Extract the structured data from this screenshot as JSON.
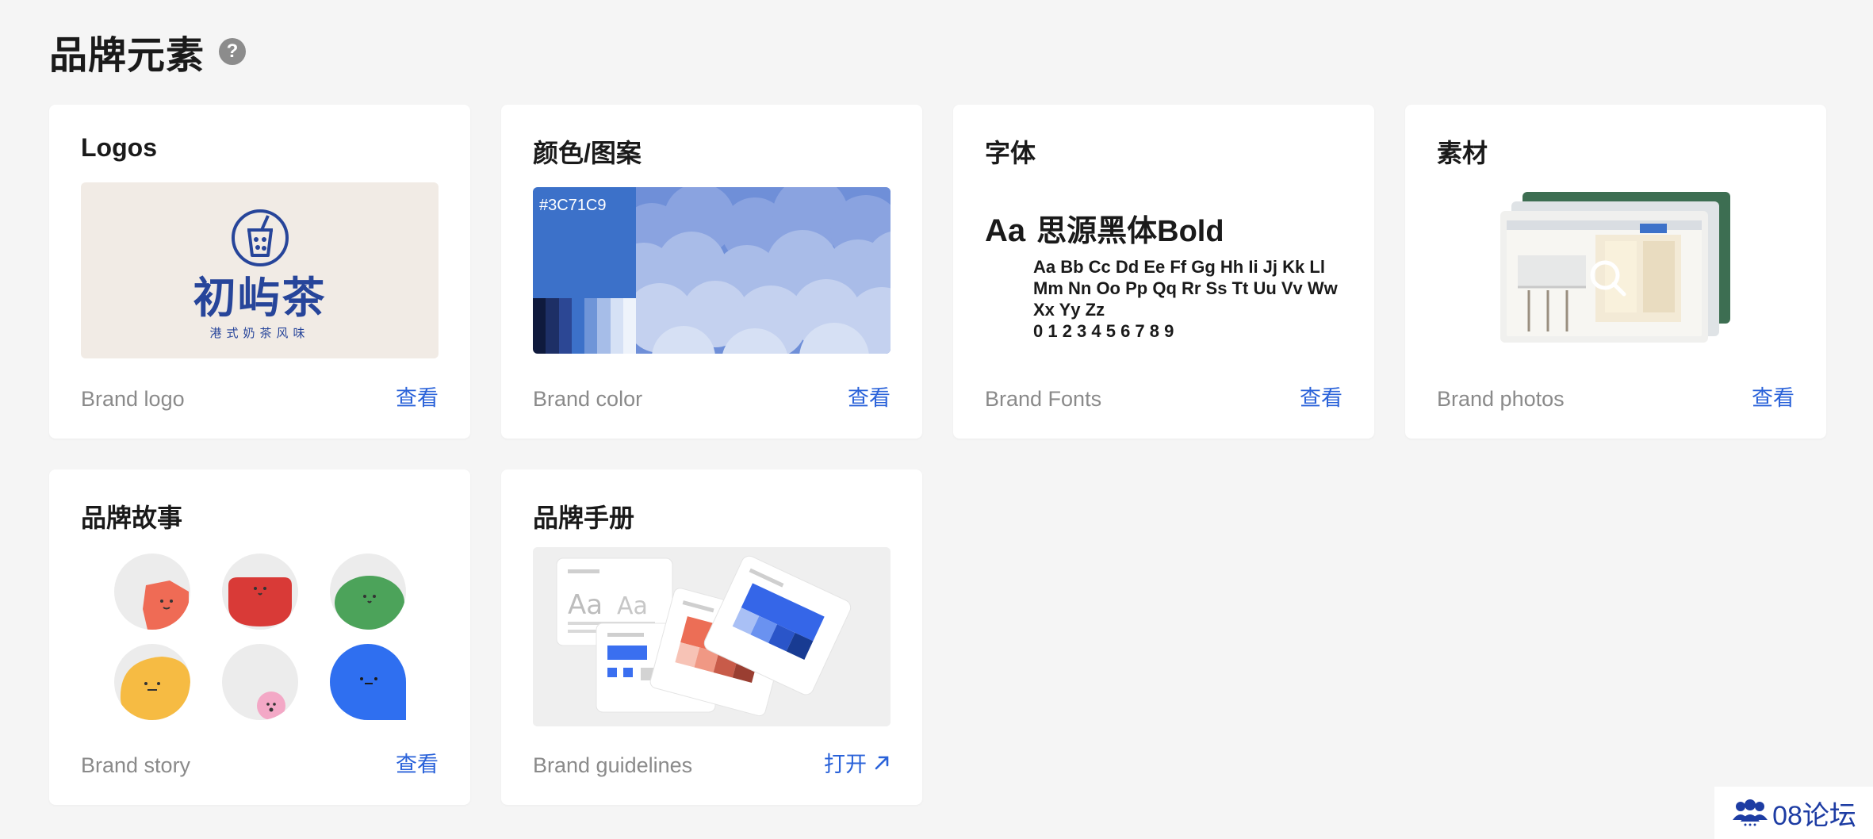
{
  "page": {
    "title": "品牌元素",
    "help_glyph": "?"
  },
  "cards": {
    "logos": {
      "title": "Logos",
      "footer": "Brand logo",
      "link": "查看",
      "logo_name": "初屿茶",
      "logo_sub": "港式奶茶风味"
    },
    "color": {
      "title": "颜色/图案",
      "footer": "Brand color",
      "link": "查看",
      "hex": "#3C71C9",
      "strip": [
        "#0f1a3d",
        "#1d2f66",
        "#2c4794",
        "#3c71c9",
        "#6f95d8",
        "#a6bde8",
        "#d6e1f5",
        "#eef3fb"
      ]
    },
    "fonts": {
      "title": "字体",
      "footer": "Brand Fonts",
      "link": "查看",
      "heading_aa": "Aa",
      "heading_name": "思源黑体Bold",
      "line1": "Aa Bb Cc Dd Ee Ff Gg Hh Ii Jj Kk Ll",
      "line2": "Mm Nn Oo Pp Qq Rr Ss Tt Uu Vv Ww",
      "line3": "Xx Yy Zz",
      "line4": "0 1 2 3 4 5 6 7 8 9"
    },
    "materials": {
      "title": "素材",
      "footer": "Brand photos",
      "link": "查看"
    },
    "story": {
      "title": "品牌故事",
      "footer": "Brand story",
      "link": "查看",
      "colors": [
        "#ef6b55",
        "#d93a37",
        "#4ca35a",
        "#f6bb43",
        "#f3a8c6",
        "#2f6ff0"
      ]
    },
    "guidelines": {
      "title": "品牌手册",
      "footer": "Brand guidelines",
      "link": "打开",
      "doc_text_a": "Aa",
      "doc_text_b": "Aa"
    }
  },
  "watermark": {
    "text": "08论坛"
  }
}
